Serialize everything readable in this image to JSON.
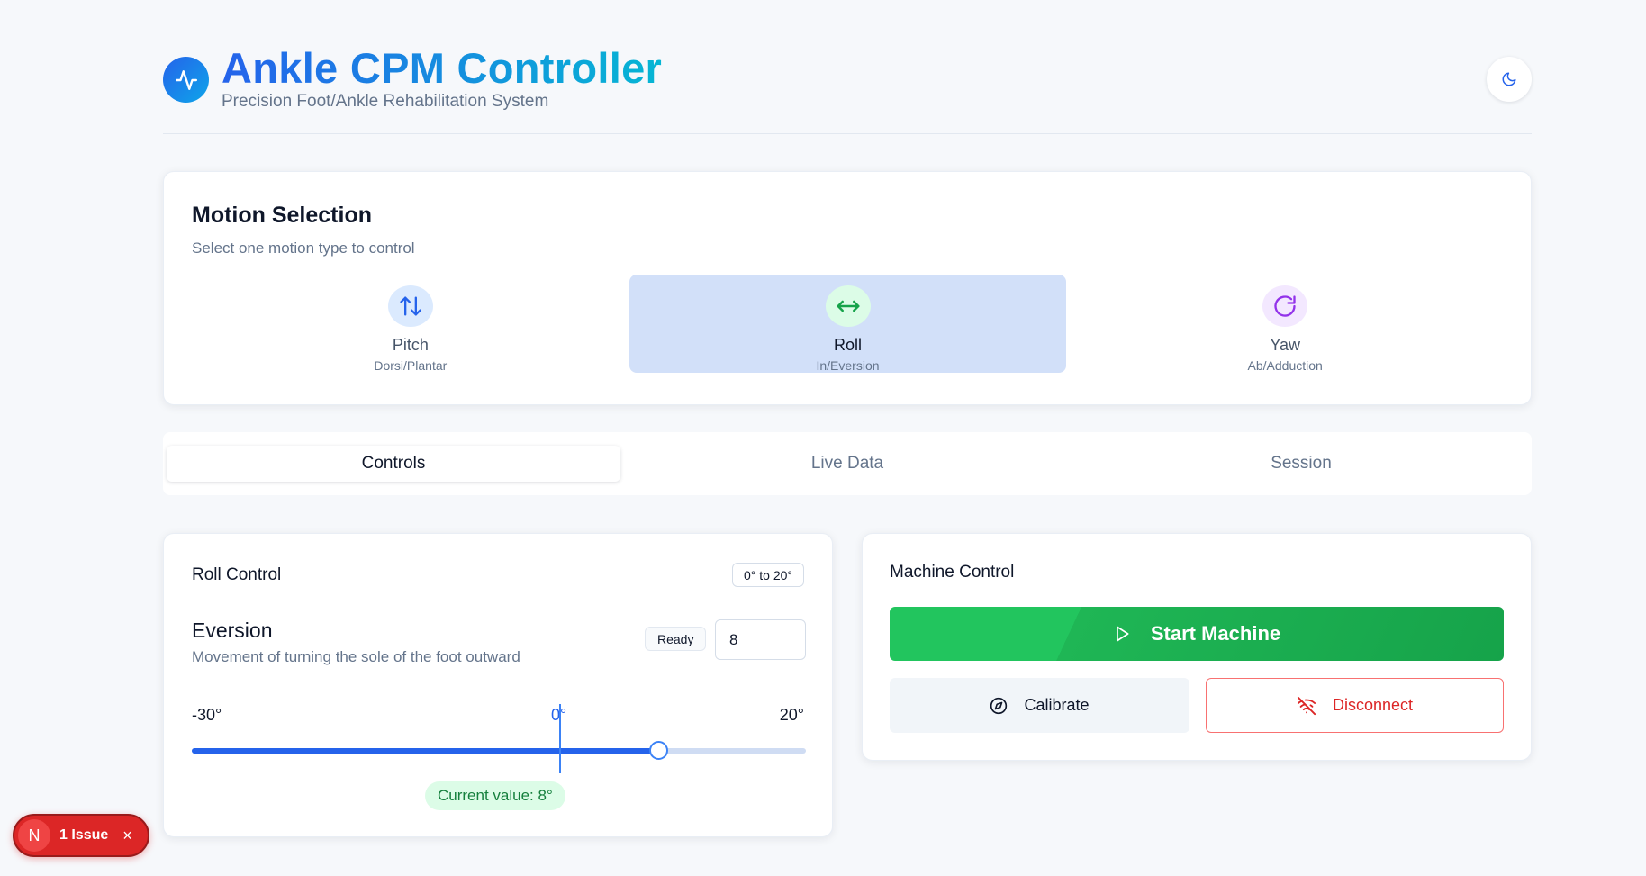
{
  "header": {
    "title": "Ankle CPM Controller",
    "subtitle": "Precision Foot/Ankle Rehabilitation System",
    "logo_icon": "activity-icon",
    "theme_toggle_icon": "moon-icon"
  },
  "motion_selection": {
    "title": "Motion Selection",
    "description": "Select one motion type to control",
    "selected": "Roll",
    "options": [
      {
        "label": "Pitch",
        "sub": "Dorsi/Plantar",
        "icon": "arrows-up-down-icon",
        "color": "#2563eb"
      },
      {
        "label": "Roll",
        "sub": "In/Eversion",
        "icon": "arrows-left-right-icon",
        "color": "#16a34a"
      },
      {
        "label": "Yaw",
        "sub": "Ab/Adduction",
        "icon": "rotate-cw-icon",
        "color": "#9333ea"
      }
    ]
  },
  "tabs": [
    {
      "label": "Controls",
      "active": true
    },
    {
      "label": "Live Data",
      "active": false
    },
    {
      "label": "Session",
      "active": false
    }
  ],
  "roll_control": {
    "title": "Roll Control",
    "range_badge": "0° to 20°",
    "motion_name": "Eversion",
    "motion_description": "Movement of turning the sole of the foot outward",
    "status": "Ready",
    "input_value": "8",
    "slider": {
      "min": -30,
      "max": 20,
      "value": 8,
      "zero": 0
    },
    "min_label": "-30°",
    "zero_label": "0°",
    "max_label": "20°",
    "current_value_label": "Current value: 8°"
  },
  "machine_control": {
    "title": "Machine Control",
    "start_label": "Start Machine",
    "calibrate_label": "Calibrate",
    "disconnect_label": "Disconnect"
  },
  "issue_indicator": {
    "avatar_letter": "N",
    "label": "1 Issue",
    "close": "×"
  },
  "colors": {
    "accent": "#2563eb",
    "success": "#22c55e",
    "danger": "#dc2626"
  }
}
